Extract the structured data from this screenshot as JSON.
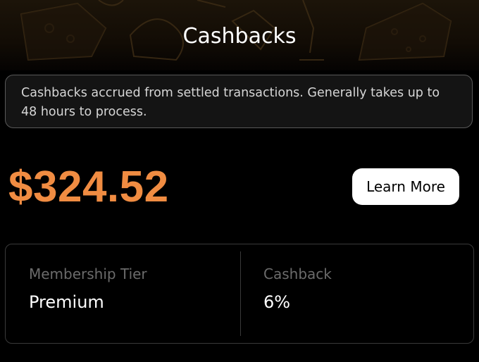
{
  "header": {
    "title": "Cashbacks"
  },
  "info": {
    "text": "Cashbacks accrued from settled transactions. Generally takes up to 48 hours to process."
  },
  "balance": {
    "amount": "$324.52",
    "learn_more_label": "Learn More"
  },
  "stats": {
    "tier_label": "Membership Tier",
    "tier_value": "Premium",
    "cashback_label": "Cashback",
    "cashback_value": "6%"
  },
  "colors": {
    "amount": "#f08c42",
    "background": "#000000",
    "button_bg": "#ffffff"
  }
}
